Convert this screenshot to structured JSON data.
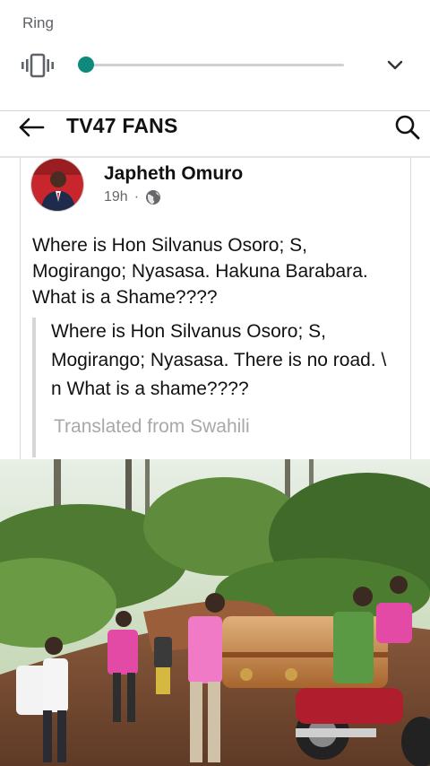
{
  "volume_panel": {
    "title": "Ring",
    "level": 0.0,
    "mode_icon": "vibrate-icon",
    "expand_icon": "chevron-down-icon"
  },
  "app_bar": {
    "title": "TV47 FANS",
    "back_icon": "arrow-left-icon",
    "search_icon": "search-icon"
  },
  "post": {
    "author": "Japheth Omuro",
    "time": "19h",
    "separator": "·",
    "privacy_icon": "globe-icon",
    "text": "Where is Hon Silvanus Osoro; S, Mogirango; Nyasasa. Hakuna Barabara. What is a Shame????",
    "translation": "Where is Hon Silvanus Osoro; S, Mogirango; Nyasasa. There is no road. \\ n What is a shame????",
    "translated_label": "Translated from Swahili"
  },
  "colors": {
    "accent": "#0f8a7c",
    "text": "#111111",
    "muted": "#65676b",
    "translated": "#a8a8a8"
  }
}
